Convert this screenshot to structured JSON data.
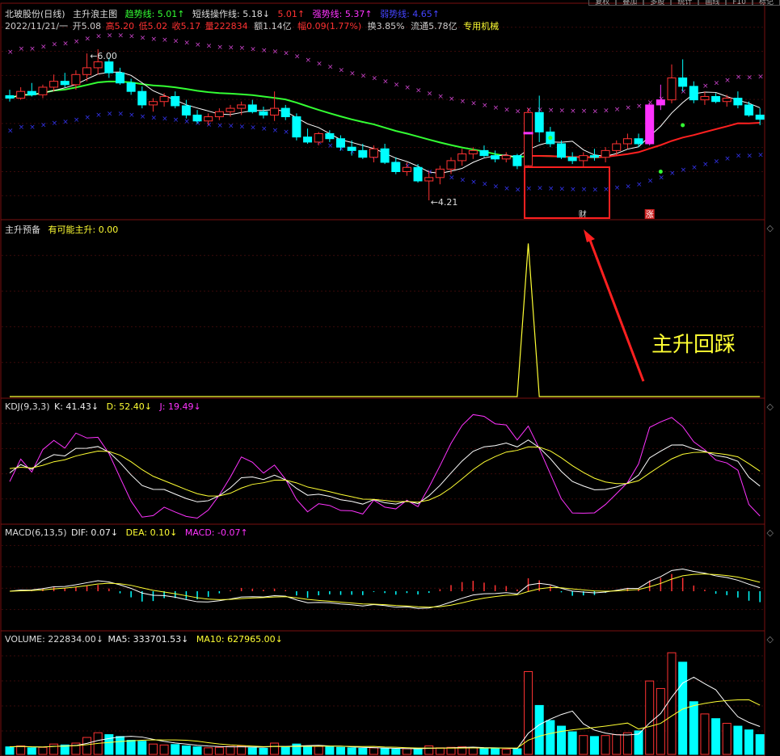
{
  "topbar": [
    "复权",
    "叠加",
    "多股",
    "统计",
    "画线",
    "F10",
    "标记"
  ],
  "main_header": {
    "stock": "北玻股份(日线)",
    "indicator": "主升浪主图",
    "trend_label": "趋势线: 5.01↑",
    "short_label": "短线操作线: 5.18↓",
    "mid_label": "5.01↑",
    "strong_label": "强势线: 5.37↑",
    "weak_label": "弱势线: 4.65↑"
  },
  "info_line": {
    "date": "2022/11/21/一",
    "open": "开5.08",
    "high": "高5.20",
    "low": "低5.02",
    "close": "收5.17",
    "vol": "量222834",
    "amount": "额1.14亿",
    "change": "幅0.09(1.77%)",
    "turnover": "换3.85%",
    "float": "流通5.78亿",
    "sector": "专用机械"
  },
  "price_labels": {
    "high": "6.00",
    "low": "4.21"
  },
  "markers": {
    "cai": "财",
    "zhang": "涨"
  },
  "annotation": "主升回踩",
  "panel2_header": {
    "name": "主升预备",
    "value": "有可能主升: 0.00"
  },
  "kdj_header": {
    "name": "KDJ(9,3,3)",
    "k": "K: 41.43↓",
    "d": "D: 52.40↓",
    "j": "J: 19.49↓"
  },
  "macd_header": {
    "name": "MACD(6,13,5)",
    "dif": "DIF: 0.07↓",
    "dea": "DEA: 0.10↓",
    "macd": "MACD: -0.07↑"
  },
  "vol_header": {
    "name": "VOLUME: 222834.00↓",
    "ma5": "MA5: 333701.53↓",
    "ma10": "MA10: 627965.00↓"
  },
  "colors": {
    "up": "#ff3232",
    "down": "#00ffff",
    "trend_green": "#33ff33",
    "trend_red": "#ff2020",
    "strong": "#cc44cc",
    "weak": "#3333ee",
    "yellow": "#ffff33",
    "magenta": "#ff33ff",
    "annotation_box": "#ff2020"
  },
  "chart_data": {
    "type": "candlestick",
    "ohlc": [
      [
        5.45,
        5.52,
        5.38,
        5.42
      ],
      [
        5.42,
        5.55,
        5.4,
        5.5
      ],
      [
        5.5,
        5.6,
        5.44,
        5.46
      ],
      [
        5.46,
        5.58,
        5.42,
        5.55
      ],
      [
        5.55,
        5.7,
        5.5,
        5.62
      ],
      [
        5.62,
        5.72,
        5.55,
        5.58
      ],
      [
        5.58,
        5.75,
        5.52,
        5.7
      ],
      [
        5.7,
        5.95,
        5.62,
        5.78
      ],
      [
        5.78,
        6.0,
        5.7,
        5.85
      ],
      [
        5.85,
        5.9,
        5.66,
        5.72
      ],
      [
        5.72,
        5.78,
        5.58,
        5.6
      ],
      [
        5.6,
        5.65,
        5.46,
        5.5
      ],
      [
        5.5,
        5.56,
        5.3,
        5.34
      ],
      [
        5.34,
        5.42,
        5.26,
        5.38
      ],
      [
        5.38,
        5.48,
        5.32,
        5.44
      ],
      [
        5.44,
        5.5,
        5.3,
        5.33
      ],
      [
        5.33,
        5.4,
        5.18,
        5.22
      ],
      [
        5.22,
        5.28,
        5.12,
        5.15
      ],
      [
        5.15,
        5.24,
        5.1,
        5.2
      ],
      [
        5.2,
        5.3,
        5.16,
        5.26
      ],
      [
        5.26,
        5.34,
        5.2,
        5.3
      ],
      [
        5.3,
        5.38,
        5.22,
        5.34
      ],
      [
        5.34,
        5.4,
        5.24,
        5.26
      ],
      [
        5.26,
        5.32,
        5.18,
        5.22
      ],
      [
        5.22,
        5.5,
        5.15,
        5.3
      ],
      [
        5.3,
        5.34,
        5.16,
        5.2
      ],
      [
        5.2,
        5.24,
        4.92,
        4.96
      ],
      [
        4.96,
        5.06,
        4.88,
        4.9
      ],
      [
        4.9,
        5.02,
        4.86,
        5.0
      ],
      [
        5.0,
        5.04,
        4.9,
        4.94
      ],
      [
        4.94,
        4.98,
        4.8,
        4.84
      ],
      [
        4.84,
        4.92,
        4.74,
        4.8
      ],
      [
        4.8,
        4.88,
        4.7,
        4.72
      ],
      [
        4.72,
        4.86,
        4.66,
        4.82
      ],
      [
        4.82,
        4.88,
        4.64,
        4.66
      ],
      [
        4.66,
        4.72,
        4.52,
        4.55
      ],
      [
        4.55,
        4.66,
        4.5,
        4.6
      ],
      [
        4.6,
        4.64,
        4.42,
        4.44
      ],
      [
        4.44,
        4.56,
        4.21,
        4.48
      ],
      [
        4.48,
        4.62,
        4.4,
        4.58
      ],
      [
        4.58,
        4.72,
        4.52,
        4.68
      ],
      [
        4.68,
        4.82,
        4.62,
        4.76
      ],
      [
        4.76,
        4.84,
        4.7,
        4.8
      ],
      [
        4.8,
        4.86,
        4.72,
        4.74
      ],
      [
        4.74,
        4.8,
        4.66,
        4.7
      ],
      [
        4.7,
        4.78,
        4.66,
        4.74
      ],
      [
        4.74,
        4.76,
        4.58,
        4.62
      ],
      [
        4.62,
        5.3,
        4.6,
        5.25
      ],
      [
        5.25,
        5.45,
        4.9,
        5.02
      ],
      [
        5.02,
        5.08,
        4.84,
        4.88
      ],
      [
        4.88,
        4.92,
        4.7,
        4.72
      ],
      [
        4.72,
        4.78,
        4.64,
        4.68
      ],
      [
        4.68,
        4.78,
        4.6,
        4.74
      ],
      [
        4.74,
        4.82,
        4.68,
        4.72
      ],
      [
        4.72,
        4.84,
        4.66,
        4.8
      ],
      [
        4.8,
        4.92,
        4.74,
        4.88
      ],
      [
        4.88,
        5.0,
        4.82,
        4.94
      ],
      [
        4.94,
        5.0,
        4.84,
        4.88
      ],
      [
        4.88,
        5.36,
        4.86,
        5.34
      ],
      [
        5.34,
        5.58,
        5.28,
        5.4
      ],
      [
        5.4,
        5.82,
        5.36,
        5.66
      ],
      [
        5.66,
        5.88,
        5.5,
        5.56
      ],
      [
        5.56,
        5.62,
        5.36,
        5.4
      ],
      [
        5.4,
        5.5,
        5.34,
        5.44
      ],
      [
        5.44,
        5.48,
        5.36,
        5.38
      ],
      [
        5.38,
        5.46,
        5.32,
        5.42
      ],
      [
        5.42,
        5.5,
        5.3,
        5.34
      ],
      [
        5.34,
        5.38,
        5.2,
        5.22
      ],
      [
        5.22,
        5.3,
        5.1,
        5.17
      ]
    ],
    "volume": [
      80,
      90,
      70,
      75,
      110,
      100,
      120,
      180,
      230,
      210,
      190,
      150,
      140,
      110,
      100,
      105,
      90,
      80,
      70,
      75,
      85,
      90,
      70,
      65,
      120,
      80,
      110,
      90,
      85,
      80,
      75,
      70,
      65,
      70,
      60,
      55,
      60,
      55,
      90,
      70,
      75,
      80,
      70,
      65,
      60,
      55,
      60,
      880,
      520,
      360,
      300,
      240,
      200,
      190,
      200,
      210,
      230,
      250,
      780,
      700,
      1080,
      980,
      560,
      430,
      380,
      330,
      300,
      260,
      210
    ],
    "volume_ylim": [
      0,
      1150
    ],
    "ylim": [
      4.0,
      6.2
    ],
    "cai_index": 52,
    "zhang_index": 58,
    "signal": {
      "values_nonzero_index": 47,
      "peak": 1.0,
      "ylim": [
        0,
        1.05
      ]
    }
  }
}
